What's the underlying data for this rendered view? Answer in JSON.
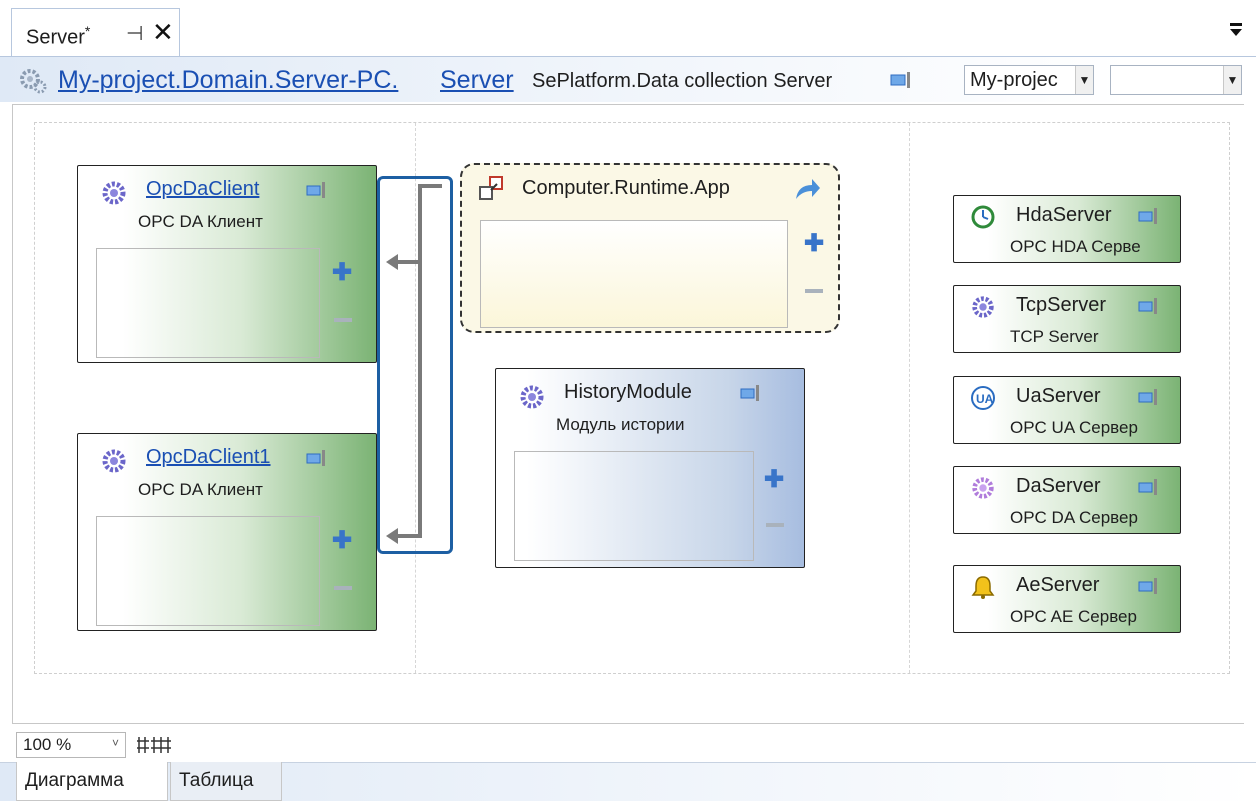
{
  "doc_tab": {
    "title": "Server",
    "modified_mark": "*",
    "pin_glyph": "⊣",
    "close_glyph": "✕"
  },
  "header": {
    "path_link": "My-project.Domain.Server-PC.",
    "server_link": "Server",
    "description": "SePlatform.Data collection Server",
    "project_combo": "My-projec",
    "empty_combo": ""
  },
  "modules": {
    "opcda_client": {
      "name": "OpcDaClient",
      "subtitle": "OPC DA Клиент"
    },
    "opcda_client1": {
      "name": "OpcDaClient1",
      "subtitle": "OPC DA Клиент"
    },
    "runtime_app": {
      "name": "Computer.Runtime.App"
    },
    "history": {
      "name": "HistoryModule",
      "subtitle": "Модуль истории"
    },
    "hda_server": {
      "name": "HdaServer",
      "subtitle": "OPC HDA Серве"
    },
    "tcp_server": {
      "name": "TcpServer",
      "subtitle": "TCP Server"
    },
    "ua_server": {
      "name": "UaServer",
      "subtitle": "OPC UA Сервер"
    },
    "da_server": {
      "name": "DaServer",
      "subtitle": "OPC DA Сервер"
    },
    "ae_server": {
      "name": "AeServer",
      "subtitle": "OPC AE Сервер"
    }
  },
  "plus_glyph": "✚",
  "zoom": {
    "value": "100 %",
    "arrow": "˅"
  },
  "bottom_tabs": {
    "diagram": "Диаграмма",
    "table": "Таблица"
  },
  "colors": {
    "link": "#1a4fb3",
    "connector": "#1d5fa3",
    "green_module": "#7bb374",
    "blue_module": "#a7bde0"
  }
}
